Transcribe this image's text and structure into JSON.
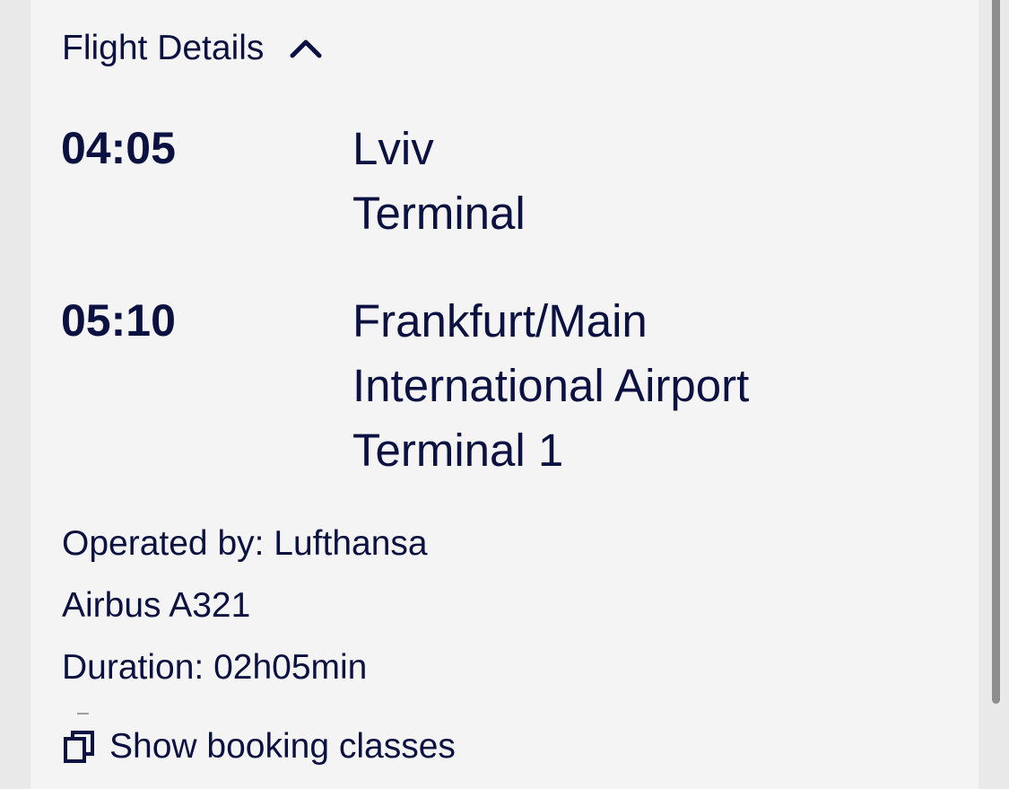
{
  "flight_details": {
    "toggle_label": "Flight Details",
    "toggle_icon": "chevron-up-icon",
    "departure": {
      "time": "04:05",
      "place_lines": [
        "Lviv",
        "Terminal"
      ]
    },
    "arrival": {
      "time": "05:10",
      "place_lines": [
        "Frankfurt/Main",
        "International Airport",
        "Terminal 1"
      ]
    },
    "operated_by": "Operated by: Lufthansa",
    "aircraft": "Airbus A321",
    "duration": "Duration: 02h05min",
    "booking_classes_link": "Show booking classes",
    "booking_classes_icon": "copy-icon"
  },
  "colors": {
    "text": "#0b1140",
    "panel_background": "#f4f4f4",
    "page_background": "#e9e9e9",
    "scrollbar_thumb": "#8e8e8e"
  }
}
